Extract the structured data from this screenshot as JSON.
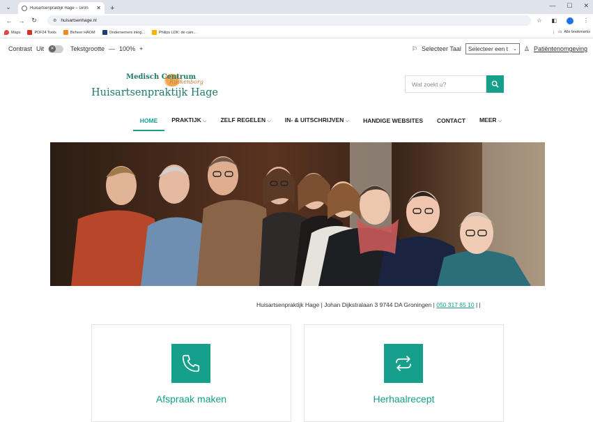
{
  "browser": {
    "tab_title": "Huisartsenpraktijk Hage – Gron",
    "url": "huisartsenhage.nl",
    "bookmarks": [
      "Maps",
      "PDF24 Tools",
      "Beheer HAOM",
      "Ondernemers inlog...",
      "Philips LDK: de cam..."
    ],
    "all_bookmarks": "Alle bookmarks"
  },
  "a11y": {
    "contrast_label": "Contrast",
    "contrast_value": "Uit",
    "textsize_label": "Tekstgrootte",
    "minus": "—",
    "zoom": "100%",
    "plus": "+",
    "language_label": "Selecteer Taal",
    "language_select": "Selecteer een t",
    "portal_link": "Patiëntenomgeving"
  },
  "logo": {
    "line1": "Medisch Centrum",
    "line1b": "Ruskenborg",
    "line2": "Huisartsenpraktijk Hage"
  },
  "search": {
    "placeholder": "Wat zoekt u?"
  },
  "nav": [
    {
      "label": "HOME",
      "caret": ""
    },
    {
      "label": "PRAKTIJK",
      "caret": "⌵"
    },
    {
      "label": "ZELF REGELEN",
      "caret": "⌵"
    },
    {
      "label": "IN- & UITSCHRIJVEN",
      "caret": "⌵"
    },
    {
      "label": "HANDIGE WEBSITES",
      "caret": ""
    },
    {
      "label": "CONTACT",
      "caret": ""
    },
    {
      "label": "MEER",
      "caret": "⌵"
    }
  ],
  "address": {
    "name": "Huisartsenpraktijk Hage",
    "sep1": "|",
    "street": "Johan Dijkstralaan 3 9744 DA Groningen",
    "sep2": "|",
    "phone": "050 317 65 10",
    "sep3": "|",
    "sep4": "|"
  },
  "cards": [
    {
      "title": "Afspraak maken",
      "icon": "phone-icon"
    },
    {
      "title": "Herhaalrecept",
      "icon": "repeat-icon"
    }
  ],
  "colors": {
    "accent": "#14a08a",
    "logo_green": "#1c7a6a"
  }
}
